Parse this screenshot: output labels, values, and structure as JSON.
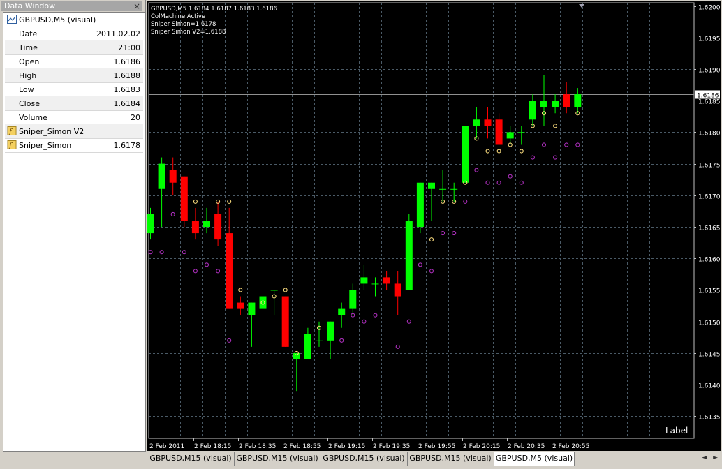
{
  "data_window": {
    "title": "Data Window",
    "close_glyph": "×",
    "header": "GBPUSD,M5 (visual)",
    "rows": [
      {
        "label": "Date",
        "value": "2011.02.02"
      },
      {
        "label": "Time",
        "value": "21:00"
      },
      {
        "label": "Open",
        "value": "1.6186"
      },
      {
        "label": "High",
        "value": "1.6188"
      },
      {
        "label": "Low",
        "value": "1.6183"
      },
      {
        "label": "Close",
        "value": "1.6184"
      },
      {
        "label": "Volume",
        "value": "20"
      }
    ],
    "indicators": [
      {
        "label": "Sniper_Simon V2",
        "value": ""
      },
      {
        "label": "Sniper_Simon",
        "value": "1.6178"
      }
    ]
  },
  "chart": {
    "info_lines": [
      "GBPUSD,M5  1.6184 1.6187 1.6183 1.6186",
      "ColMachine Active",
      "Sniper Simon=1.6178",
      "Sniper Simon V2=1.6188"
    ],
    "current_price_label": "1.6186",
    "label_text": "Label",
    "bull_color": "#00ff00",
    "bear_color": "#ff0000",
    "grid_color": "#4a5a66",
    "upper_marker_color": "#ffe080",
    "lower_marker_color": "#b030c0"
  },
  "chart_data": {
    "type": "candlestick",
    "symbol": "GBPUSD",
    "timeframe": "M5",
    "y_ticks": [
      "1.6200",
      "1.6195",
      "1.6190",
      "1.6185",
      "1.6180",
      "1.6175",
      "1.6170",
      "1.6165",
      "1.6160",
      "1.6155",
      "1.6150",
      "1.6145",
      "1.6140",
      "1.6135"
    ],
    "x_ticks": [
      "2 Feb 2011",
      "2 Feb 18:15",
      "2 Feb 18:35",
      "2 Feb 18:55",
      "2 Feb 19:15",
      "2 Feb 19:35",
      "2 Feb 19:55",
      "2 Feb 20:15",
      "2 Feb 20:35",
      "2 Feb 20:55"
    ],
    "ylim": [
      1.61315,
      1.62005
    ],
    "candles": [
      {
        "o": 1.6164,
        "h": 1.6168,
        "l": 1.6163,
        "c": 1.6167
      },
      {
        "o": 1.6171,
        "h": 1.6176,
        "l": 1.6165,
        "c": 1.6175
      },
      {
        "o": 1.6174,
        "h": 1.6176,
        "l": 1.617,
        "c": 1.6172
      },
      {
        "o": 1.6173,
        "h": 1.6173,
        "l": 1.6165,
        "c": 1.6166
      },
      {
        "o": 1.6166,
        "h": 1.6168,
        "l": 1.6163,
        "c": 1.6164
      },
      {
        "o": 1.6165,
        "h": 1.6168,
        "l": 1.6164,
        "c": 1.6166
      },
      {
        "o": 1.6167,
        "h": 1.6169,
        "l": 1.6162,
        "c": 1.6163
      },
      {
        "o": 1.6164,
        "h": 1.6168,
        "l": 1.6152,
        "c": 1.6152
      },
      {
        "o": 1.6153,
        "h": 1.6154,
        "l": 1.6151,
        "c": 1.6152
      },
      {
        "o": 1.6151,
        "h": 1.6153,
        "l": 1.6146,
        "c": 1.6153
      },
      {
        "o": 1.6152,
        "h": 1.6154,
        "l": 1.6146,
        "c": 1.6154
      },
      {
        "o": 1.6155,
        "h": 1.6155,
        "l": 1.6151,
        "c": 1.6155
      },
      {
        "o": 1.6154,
        "h": 1.6154,
        "l": 1.6146,
        "c": 1.6146
      },
      {
        "o": 1.6144,
        "h": 1.6145,
        "l": 1.6139,
        "c": 1.6145
      },
      {
        "o": 1.6144,
        "h": 1.6149,
        "l": 1.6144,
        "c": 1.6148
      },
      {
        "o": 1.6147,
        "h": 1.615,
        "l": 1.6146,
        "c": 1.6147
      },
      {
        "o": 1.6147,
        "h": 1.615,
        "l": 1.6144,
        "c": 1.615
      },
      {
        "o": 1.6151,
        "h": 1.6153,
        "l": 1.6149,
        "c": 1.6152
      },
      {
        "o": 1.6152,
        "h": 1.6156,
        "l": 1.6151,
        "c": 1.6155
      },
      {
        "o": 1.6156,
        "h": 1.6159,
        "l": 1.6155,
        "c": 1.6157
      },
      {
        "o": 1.6156,
        "h": 1.6157,
        "l": 1.6154,
        "c": 1.6156
      },
      {
        "o": 1.6157,
        "h": 1.6158,
        "l": 1.6155,
        "c": 1.6156
      },
      {
        "o": 1.6156,
        "h": 1.6158,
        "l": 1.6151,
        "c": 1.6154
      },
      {
        "o": 1.6155,
        "h": 1.6167,
        "l": 1.6155,
        "c": 1.6166
      },
      {
        "o": 1.6165,
        "h": 1.6172,
        "l": 1.6164,
        "c": 1.6172
      },
      {
        "o": 1.6171,
        "h": 1.6172,
        "l": 1.6166,
        "c": 1.6172
      },
      {
        "o": 1.6171,
        "h": 1.6174,
        "l": 1.6169,
        "c": 1.6171
      },
      {
        "o": 1.6171,
        "h": 1.6172,
        "l": 1.6169,
        "c": 1.6171
      },
      {
        "o": 1.6172,
        "h": 1.6181,
        "l": 1.6172,
        "c": 1.6181
      },
      {
        "o": 1.6181,
        "h": 1.6184,
        "l": 1.6179,
        "c": 1.6182
      },
      {
        "o": 1.6182,
        "h": 1.6184,
        "l": 1.6179,
        "c": 1.6181
      },
      {
        "o": 1.6182,
        "h": 1.6183,
        "l": 1.6178,
        "c": 1.6178
      },
      {
        "o": 1.6179,
        "h": 1.6181,
        "l": 1.6178,
        "c": 1.618
      },
      {
        "o": 1.618,
        "h": 1.6181,
        "l": 1.6178,
        "c": 1.618
      },
      {
        "o": 1.6182,
        "h": 1.6186,
        "l": 1.6181,
        "c": 1.6185
      },
      {
        "o": 1.6184,
        "h": 1.6189,
        "l": 1.6181,
        "c": 1.6185
      },
      {
        "o": 1.6184,
        "h": 1.6186,
        "l": 1.6183,
        "c": 1.6185
      },
      {
        "o": 1.6186,
        "h": 1.6188,
        "l": 1.6183,
        "c": 1.6184
      },
      {
        "o": 1.6184,
        "h": 1.6187,
        "l": 1.6183,
        "c": 1.6186
      }
    ],
    "upper_markers": [
      {
        "i": 4,
        "y": 1.6169
      },
      {
        "i": 6,
        "y": 1.6169
      },
      {
        "i": 7,
        "y": 1.6169
      },
      {
        "i": 8,
        "y": 1.6155
      },
      {
        "i": 10,
        "y": 1.6153
      },
      {
        "i": 11,
        "y": 1.6154
      },
      {
        "i": 12,
        "y": 1.6155
      },
      {
        "i": 13,
        "y": 1.6145
      },
      {
        "i": 15,
        "y": 1.6149
      },
      {
        "i": 25,
        "y": 1.6163
      },
      {
        "i": 26,
        "y": 1.6169
      },
      {
        "i": 27,
        "y": 1.6169
      },
      {
        "i": 28,
        "y": 1.6172
      },
      {
        "i": 29,
        "y": 1.6179
      },
      {
        "i": 30,
        "y": 1.6177
      },
      {
        "i": 31,
        "y": 1.6177
      },
      {
        "i": 32,
        "y": 1.6178
      },
      {
        "i": 33,
        "y": 1.6177
      },
      {
        "i": 34,
        "y": 1.6181
      },
      {
        "i": 35,
        "y": 1.6183
      },
      {
        "i": 36,
        "y": 1.6181
      },
      {
        "i": 38,
        "y": 1.6183
      }
    ],
    "lower_markers": [
      {
        "i": 0,
        "y": 1.6161
      },
      {
        "i": 1,
        "y": 1.6161
      },
      {
        "i": 2,
        "y": 1.6167
      },
      {
        "i": 3,
        "y": 1.6161
      },
      {
        "i": 4,
        "y": 1.6158
      },
      {
        "i": 5,
        "y": 1.6159
      },
      {
        "i": 6,
        "y": 1.6158
      },
      {
        "i": 7,
        "y": 1.6147
      },
      {
        "i": 17,
        "y": 1.6147
      },
      {
        "i": 18,
        "y": 1.6151
      },
      {
        "i": 19,
        "y": 1.615
      },
      {
        "i": 20,
        "y": 1.6151
      },
      {
        "i": 22,
        "y": 1.6146
      },
      {
        "i": 23,
        "y": 1.615
      },
      {
        "i": 24,
        "y": 1.6159
      },
      {
        "i": 25,
        "y": 1.6158
      },
      {
        "i": 26,
        "y": 1.6164
      },
      {
        "i": 27,
        "y": 1.6164
      },
      {
        "i": 28,
        "y": 1.6169
      },
      {
        "i": 29,
        "y": 1.6174
      },
      {
        "i": 30,
        "y": 1.6172
      },
      {
        "i": 31,
        "y": 1.6172
      },
      {
        "i": 32,
        "y": 1.6173
      },
      {
        "i": 33,
        "y": 1.6172
      },
      {
        "i": 34,
        "y": 1.6176
      },
      {
        "i": 35,
        "y": 1.6178
      },
      {
        "i": 36,
        "y": 1.6176
      },
      {
        "i": 37,
        "y": 1.6178
      },
      {
        "i": 38,
        "y": 1.6178
      }
    ],
    "current_price": 1.6186
  },
  "tabs": [
    {
      "label": "GBPUSD,M15 (visual)",
      "active": false
    },
    {
      "label": "GBPUSD,M15 (visual)",
      "active": false
    },
    {
      "label": "GBPUSD,M15 (visual)",
      "active": false
    },
    {
      "label": "GBPUSD,M15 (visual)",
      "active": false
    },
    {
      "label": "GBPUSD,M5 (visual)",
      "active": true
    }
  ],
  "tab_arrows": [
    "◄",
    "►"
  ]
}
